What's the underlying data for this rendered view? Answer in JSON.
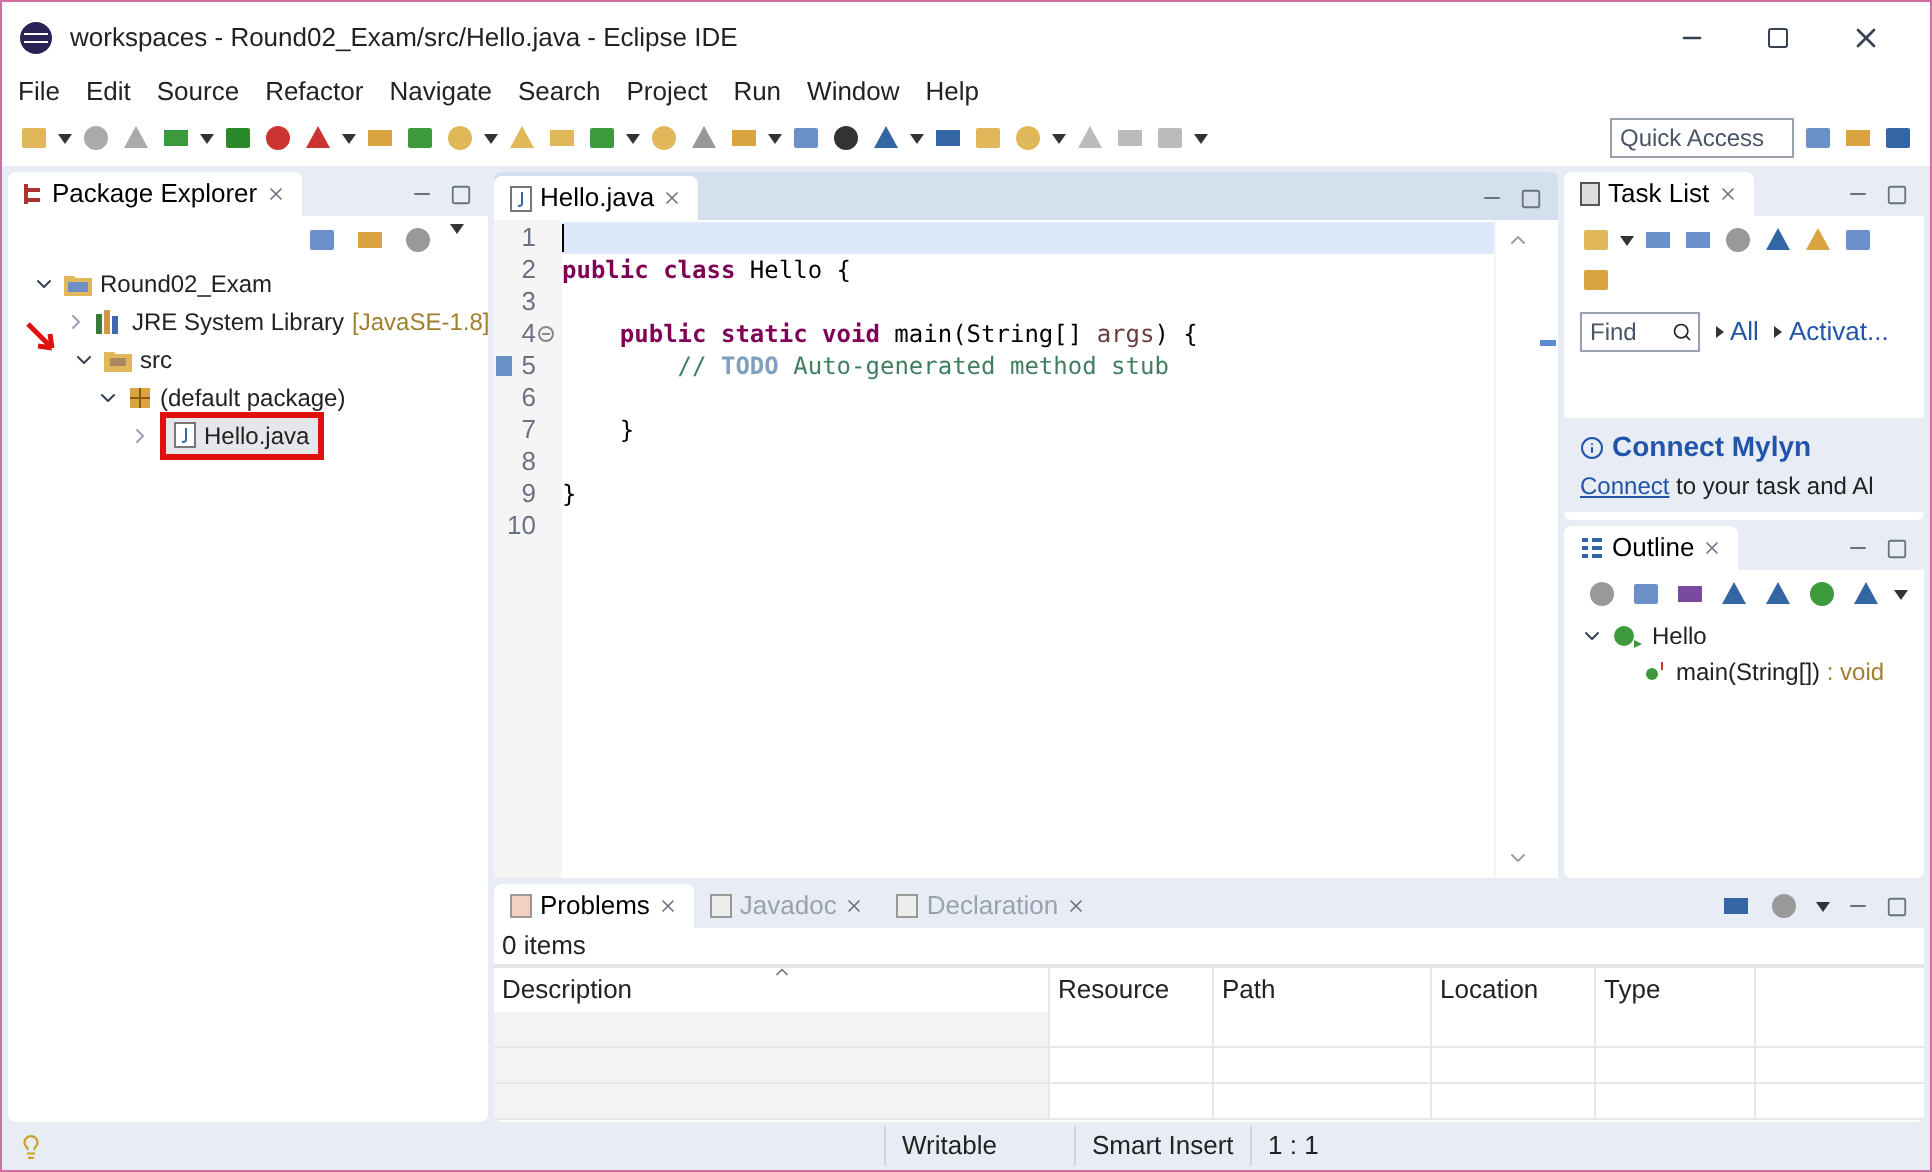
{
  "window": {
    "title": "workspaces - Round02_Exam/src/Hello.java - Eclipse IDE"
  },
  "menu": [
    "File",
    "Edit",
    "Source",
    "Refactor",
    "Navigate",
    "Search",
    "Project",
    "Run",
    "Window",
    "Help"
  ],
  "quick_access": {
    "placeholder": "Quick Access"
  },
  "package_explorer": {
    "tab": {
      "label": "Package Explorer",
      "selected": true
    },
    "tree": [
      {
        "label": "Round02_Exam",
        "kind": "project",
        "expanded": true,
        "boxed": false,
        "children": [
          {
            "label": "JRE System Library",
            "decoration": "[JavaSE-1.8]",
            "kind": "library",
            "expanded": false,
            "boxed": false
          },
          {
            "label": "src",
            "kind": "folder",
            "expanded": true,
            "boxed": false,
            "pointer_arrow": true,
            "children": [
              {
                "label": "(default package)",
                "kind": "package",
                "expanded": true,
                "boxed": false,
                "children": [
                  {
                    "label": "Hello.java",
                    "kind": "file",
                    "expanded": false,
                    "boxed": true
                  }
                ]
              }
            ]
          }
        ]
      }
    ]
  },
  "editor": {
    "tab": {
      "label": "Hello.java",
      "selected": true
    },
    "lines": [
      {
        "number": "1",
        "current": true
      },
      {
        "number": "2",
        "current": false,
        "tokens": [
          {
            "kind": "keyword",
            "text": "public class"
          },
          {
            "kind": "plain",
            "text": " Hello {"
          }
        ]
      },
      {
        "number": "3",
        "current": false
      },
      {
        "number": "4",
        "current": false,
        "fold": true,
        "tokens": [
          {
            "kind": "keyword",
            "text": "    public static void"
          },
          {
            "kind": "plain",
            "text": " main(String[] "
          },
          {
            "kind": "param",
            "text": "args"
          },
          {
            "kind": "plain",
            "text": ") {"
          }
        ]
      },
      {
        "number": "5",
        "current": false,
        "task_marker": true,
        "tokens": [
          {
            "kind": "comment",
            "text": "        // "
          },
          {
            "kind": "todo",
            "text": "TODO"
          },
          {
            "kind": "comment",
            "text": " Auto-generated method stub"
          }
        ]
      },
      {
        "number": "6",
        "current": false
      },
      {
        "number": "7",
        "current": false,
        "tokens": [
          {
            "kind": "plain",
            "text": "    }"
          }
        ]
      },
      {
        "number": "8",
        "current": false
      },
      {
        "number": "9",
        "current": false,
        "tokens": [
          {
            "kind": "plain",
            "text": "}"
          }
        ]
      },
      {
        "number": "10",
        "current": false
      }
    ]
  },
  "task_list": {
    "tab": {
      "label": "Task List",
      "selected": true
    },
    "find": {
      "placeholder": "Find"
    },
    "filters": [
      "All",
      "Activat..."
    ],
    "connect": {
      "title": "Connect Mylyn",
      "link": "Connect",
      "text": " to your task and Al"
    }
  },
  "outline": {
    "tab": {
      "label": "Outline",
      "selected": true
    },
    "tree": [
      {
        "label": "Hello",
        "kind": "class",
        "expanded": true,
        "children": [
          {
            "label": "main(String[])",
            "type": " : void",
            "kind": "method"
          }
        ]
      }
    ]
  },
  "bottom_panel": {
    "tabs": [
      {
        "label": "Problems",
        "selected": true
      },
      {
        "label": "Javadoc",
        "selected": false
      },
      {
        "label": "Declaration",
        "selected": false
      }
    ],
    "summary": "0 items",
    "columns": [
      {
        "label": "Description",
        "sorted": true
      },
      {
        "label": "Resource",
        "sorted": false
      },
      {
        "label": "Path",
        "sorted": false
      },
      {
        "label": "Location",
        "sorted": false
      },
      {
        "label": "Type",
        "sorted": false
      }
    ]
  },
  "status_bar": [
    "Writable",
    "Smart Insert",
    "1 : 1"
  ]
}
